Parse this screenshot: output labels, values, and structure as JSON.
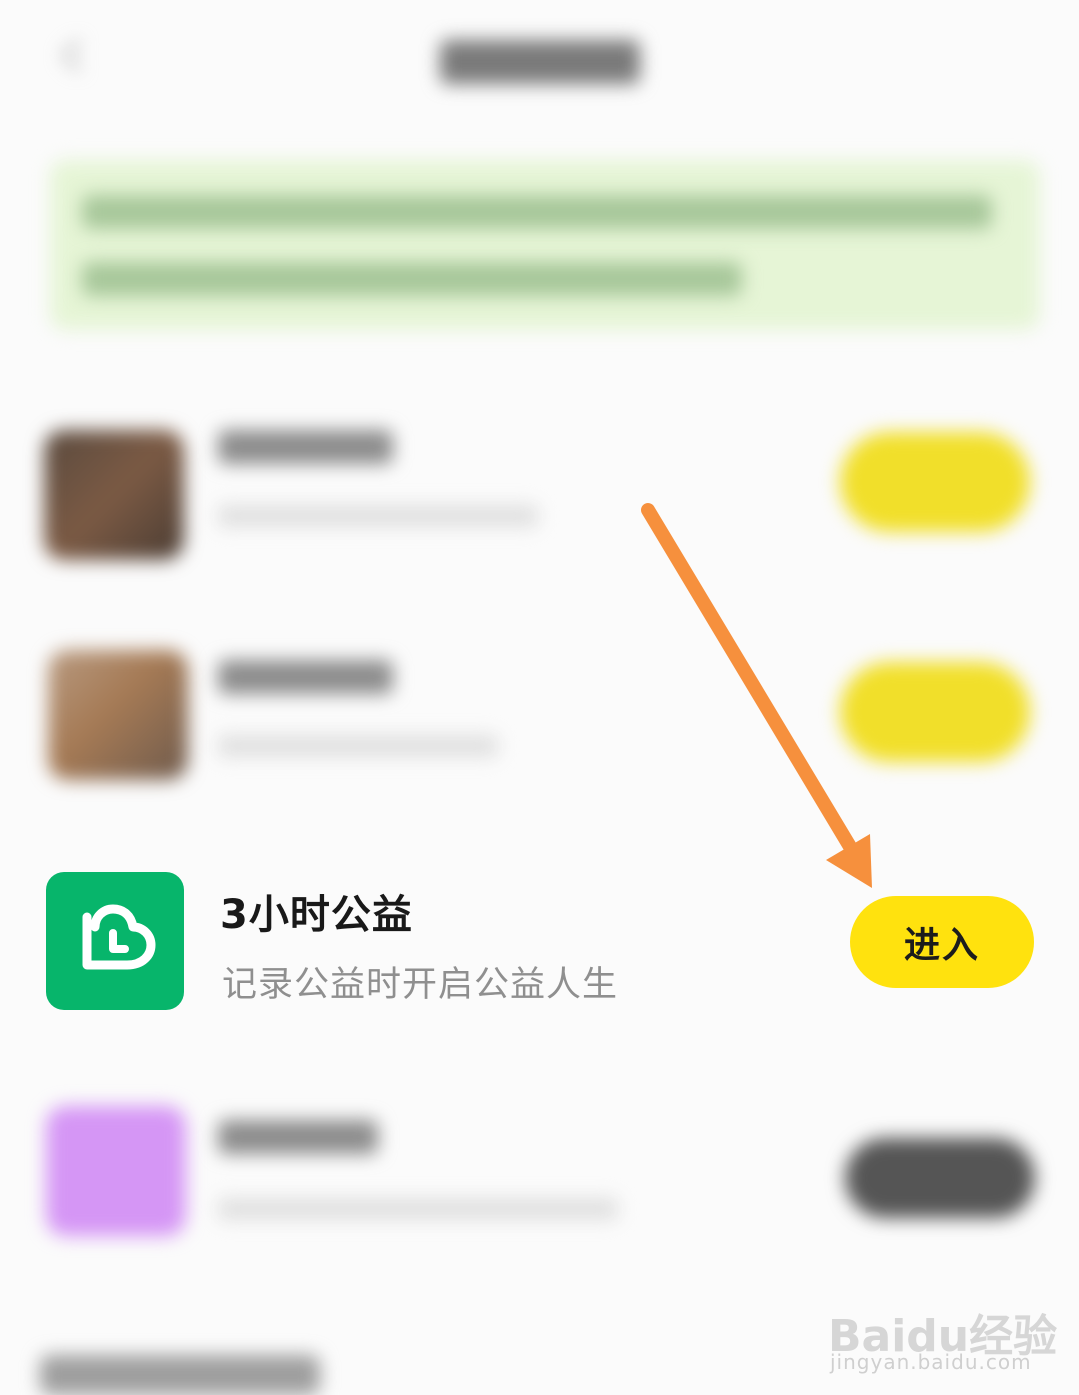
{
  "list": {
    "featured": {
      "title": "3小时公益",
      "subtitle": "记录公益时开启公益人生",
      "enter_label": "进入",
      "icon": "heart-leaf-icon",
      "icon_bg": "#07b56b",
      "button_color": "#ffe20e"
    }
  },
  "annotation": {
    "arrow_color": "#f6903d"
  },
  "watermark": {
    "logo_text": "Baidu经验",
    "url": "jingyan.baidu.com"
  }
}
